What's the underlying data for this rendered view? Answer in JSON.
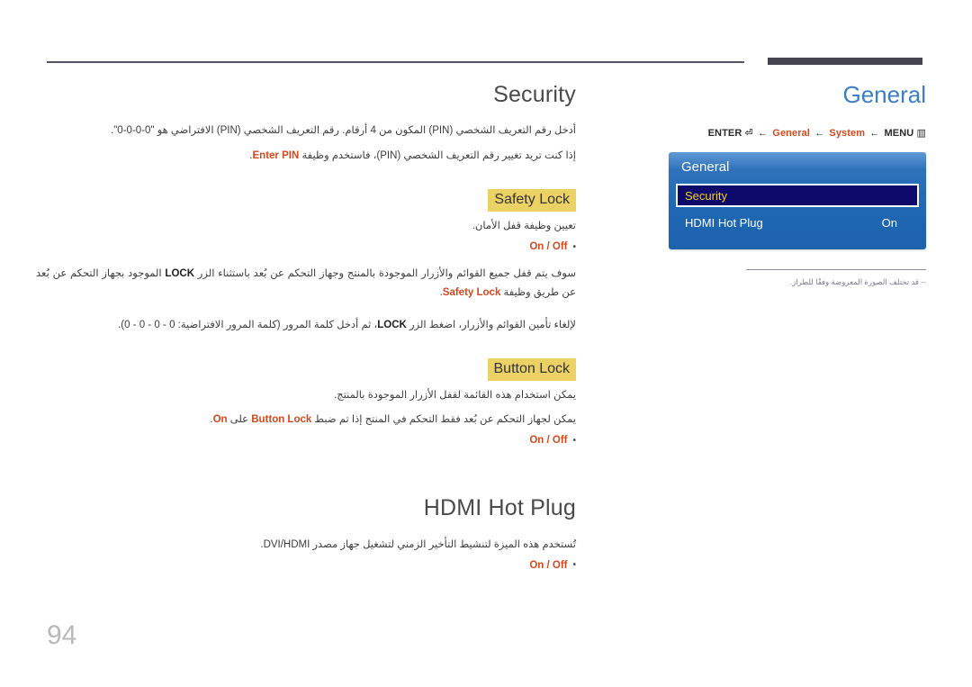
{
  "page": {
    "number": "94"
  },
  "right": {
    "heading": "General",
    "breadcrumb": {
      "enter": "ENTER",
      "enter_glyph": "⏎",
      "arrow": "←",
      "general": "General",
      "system": "System",
      "menu": "MENU",
      "menu_glyph": "▥"
    },
    "osd": {
      "title": "General",
      "rows": [
        {
          "label": "Security",
          "value": "",
          "selected": true
        },
        {
          "label": "HDMI Hot Plug",
          "value": "On",
          "selected": false
        }
      ]
    },
    "note": "-- قد تختلف الصورة المعروضة وفقًا للطراز."
  },
  "main": {
    "security": {
      "title": "Security",
      "para1_a": "أدخل رقم التعريف الشخصي (PIN) المكون من 4 أرقام. رقم التعريف الشخصي (PIN) الافتراضي هو \"",
      "para1_pin": "0-0-0-0",
      "para1_b": "\".",
      "para2_a": "إذا كنت تريد تغيير رقم التعريف الشخصي (PIN)، فاستخدم وظيفة ",
      "para2_link": "Enter PIN",
      "para2_b": "."
    },
    "safety_lock": {
      "chip": "Safety Lock",
      "desc": "تعيين وظيفة قفل الأمان.",
      "bullet": "On / Off",
      "para1_a": "سوف يتم قفل جميع القوائم والأزرار الموجودة بالمنتج وجهاز التحكم عن بُعد باستثناء الزر ",
      "para1_lock": "LOCK",
      "para1_b": " الموجود بجهاز التحكم عن بُعد عن طريق وظيفة ",
      "para1_link": "Safety Lock",
      "para1_c": ".",
      "para2_a": "لإلغاء تأمين القوائم والأزرار، اضغط الزر ",
      "para2_lock": "LOCK",
      "para2_b": "، ثم أدخل كلمة المرور (كلمة المرور الافتراضية: 0 - 0 - 0 - 0)."
    },
    "button_lock": {
      "chip": "Button Lock",
      "desc1": "يمكن استخدام هذه القائمة لقفل الأزرار الموجودة بالمنتج.",
      "desc2_a": "يمكن لجهاز التحكم عن بُعد فقط التحكم في المنتج إذا تم ضبط ",
      "desc2_link": "Button Lock",
      "desc2_b": " على ",
      "desc2_on": "On",
      "desc2_c": ".",
      "bullet": "On / Off"
    },
    "hdmi_hot_plug": {
      "title": "HDMI Hot Plug",
      "desc": "تُستخدم هذه الميزة لتنشيط التأخير الزمني لتشغيل جهاز مصدر DVI/HDMI.",
      "bullet": "On / Off"
    }
  }
}
